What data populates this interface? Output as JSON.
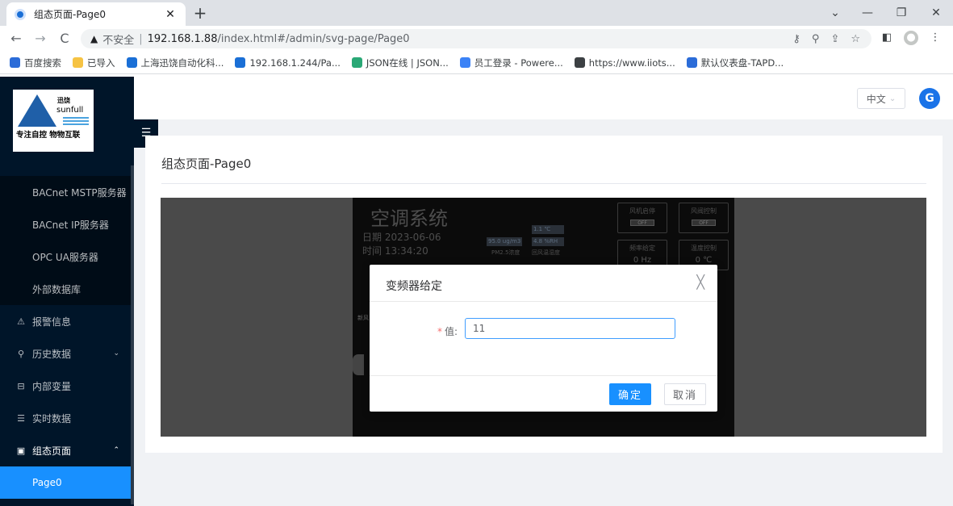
{
  "browser": {
    "tab_title": "组态页面-Page0",
    "tab_close": "✕",
    "new_tab": "+",
    "window_controls": [
      "⌄",
      "—",
      "❐",
      "✕"
    ],
    "nav": {
      "back": "←",
      "forward": "→",
      "reload": "C"
    },
    "security_icon": "▲",
    "security_text": "不安全",
    "url_host": "192.168.1.88",
    "url_path": "/index.html#/admin/svg-page/Page0",
    "omnibox_icons": [
      "key-icon",
      "zoom-icon",
      "share-icon",
      "star-icon"
    ],
    "bookmarks": [
      {
        "label": "百度搜索",
        "icon_color": "#2b6cd8"
      },
      {
        "label": "已导入",
        "icon_color": "#f6c343"
      },
      {
        "label": "上海迅饶自动化科...",
        "icon_color": "#1a6fd6"
      },
      {
        "label": "192.168.1.244/Pa...",
        "icon_color": "#1a6fd6"
      },
      {
        "label": "JSON在线 | JSON...",
        "icon_color": "#2aa876"
      },
      {
        "label": "员工登录 - Powere...",
        "icon_color": "#3b82f6"
      },
      {
        "label": "https://www.iiots...",
        "icon_color": "#3c4043"
      },
      {
        "label": "默认仪表盘-TAPD...",
        "icon_color": "#2b6cd8"
      }
    ]
  },
  "app": {
    "logo": {
      "cn": "迅饶",
      "en": "sunfull",
      "slogan": "专注自控 物物互联"
    },
    "collapse_icon": "☰",
    "submenu": [
      "BACnet MSTP服务器",
      "BACnet IP服务器",
      "OPC UA服务器",
      "外部数据库"
    ],
    "menu": [
      {
        "icon": "⚠",
        "label": "报警信息",
        "arrow": ""
      },
      {
        "icon": "⚲",
        "label": "历史数据",
        "arrow": "⌄"
      },
      {
        "icon": "⊟",
        "label": "内部变量",
        "arrow": ""
      },
      {
        "icon": "☰",
        "label": "实时数据",
        "arrow": ""
      },
      {
        "icon": "▣",
        "label": "组态页面",
        "arrow": "⌃"
      }
    ],
    "active_item": "Page0",
    "language": "中文",
    "lang_arrow": "⌄",
    "avatar_letter": "G",
    "page_title": "组态页面-Page0"
  },
  "hmi": {
    "title": "空调系统",
    "date": "日期 2023-06-06",
    "time": "时间 13:34:20",
    "pm_value": "95.0 ug/m3",
    "pm_label": "PM2.5浓度",
    "temp_value": "1.1 ℃",
    "humidity_value": "4.8 %RH",
    "return_label": "回风温湿度",
    "controls": [
      {
        "label": "风机启停",
        "switch": "OFF"
      },
      {
        "label": "风阀控制",
        "switch": "OFF"
      },
      {
        "label": "频率给定",
        "value": "0 Hz"
      },
      {
        "label": "温度控制",
        "value": "0 ℃"
      }
    ],
    "side_label": "新风"
  },
  "dialog": {
    "title": "变频器给定",
    "close": "╳",
    "required_mark": "*",
    "field_label": "值:",
    "field_value": "11",
    "ok": "确定",
    "cancel": "取消"
  }
}
